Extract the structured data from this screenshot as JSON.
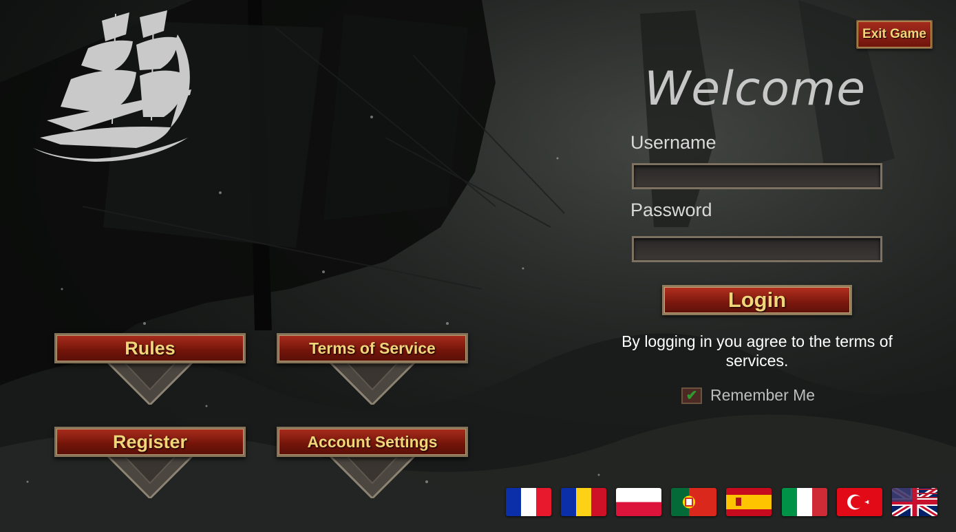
{
  "header": {
    "exit_label": "Exit Game"
  },
  "login": {
    "welcome": "Welcome",
    "username_label": "Username",
    "username_value": "",
    "password_label": "Password",
    "password_value": "",
    "login_label": "Login",
    "agree_text": "By logging in you agree to the terms of services.",
    "remember_label": "Remember Me",
    "remember_checked": true
  },
  "menu": {
    "rules": "Rules",
    "terms": "Terms of Service",
    "register": "Register",
    "account": "Account Settings"
  },
  "languages": [
    "french-flag",
    "romanian-flag",
    "polish-flag",
    "portuguese-flag",
    "spanish-flag",
    "italian-flag",
    "turkish-flag",
    "english-flag"
  ],
  "colors": {
    "button_red": "#8b1c10",
    "button_text": "#f2d57a",
    "frame": "#85735a"
  }
}
